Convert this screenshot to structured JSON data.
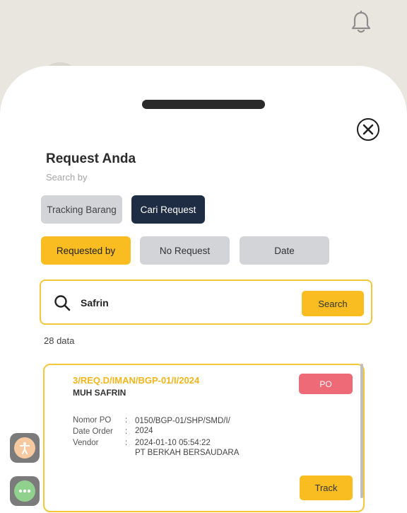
{
  "header": {
    "bell_icon": "bell-icon"
  },
  "sheet": {
    "title": "Request Anda",
    "subtitle": "Search by",
    "close_icon": "close-circle-icon",
    "mode_tabs": [
      {
        "label": "Tracking Barang",
        "active": false
      },
      {
        "label": "Cari Request",
        "active": true
      }
    ],
    "filters": [
      {
        "label": "Requested by",
        "active": true
      },
      {
        "label": "No Request",
        "active": false
      },
      {
        "label": "Date",
        "active": false
      }
    ],
    "search": {
      "value": "Safrin",
      "button_label": "Search",
      "icon": "search-icon"
    },
    "data_count": "28 data",
    "results": [
      {
        "request_id": "3/REQ.D/IMAN/BGP-01/I/2024",
        "requester": "MUH SAFRIN",
        "badge": "PO",
        "details": [
          {
            "label": "Nomor PO",
            "value": "0150/BGP-01/SHP/SMD/I/\n2024"
          },
          {
            "label": "Date Order",
            "value": "2024-01-10 05:54:22"
          },
          {
            "label": "Vendor",
            "value": "PT BERKAH BERSAUDARA"
          }
        ],
        "track_label": "Track"
      }
    ]
  },
  "colors": {
    "accent": "#f9bd21",
    "dark": "#1f2d44",
    "badge_po": "#ee6a77",
    "inactive": "#d3d4d8"
  }
}
